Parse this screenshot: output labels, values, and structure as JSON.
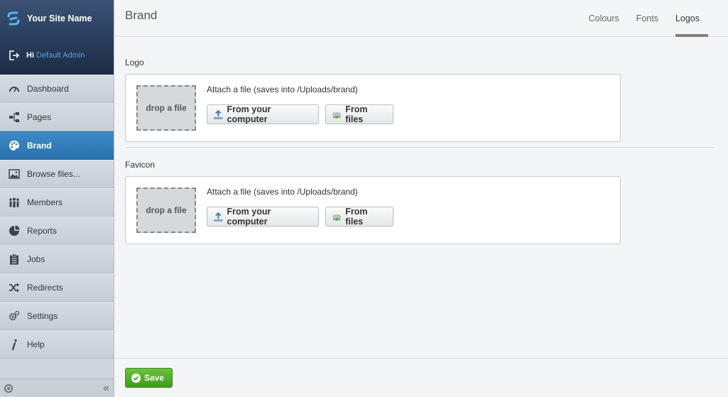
{
  "brand": {
    "site_name": "Your Site Name"
  },
  "user": {
    "greeting": "Hi",
    "name": "Default Admin"
  },
  "sidebar": {
    "items": [
      {
        "label": "Dashboard",
        "icon": "dashboard-gauge-icon"
      },
      {
        "label": "Pages",
        "icon": "sitemap-icon"
      },
      {
        "label": "Brand",
        "icon": "palette-icon",
        "active": true
      },
      {
        "label": "Browse files...",
        "icon": "image-icon"
      },
      {
        "label": "Members",
        "icon": "people-icon"
      },
      {
        "label": "Reports",
        "icon": "pie-chart-icon"
      },
      {
        "label": "Jobs",
        "icon": "clipboard-icon"
      },
      {
        "label": "Redirects",
        "icon": "shuffle-icon"
      },
      {
        "label": "Settings",
        "icon": "gears-icon"
      },
      {
        "label": "Help",
        "icon": "info-icon"
      }
    ],
    "footer": {
      "collapse_glyph": "«"
    }
  },
  "header": {
    "title": "Brand",
    "tabs": [
      {
        "label": "Colours"
      },
      {
        "label": "Fonts"
      },
      {
        "label": "Logos",
        "active": true
      }
    ]
  },
  "sections": [
    {
      "label": "Logo",
      "dropzone_text": "drop a file",
      "attach_text": "Attach a file (saves into /Uploads/brand)",
      "computer_button": "From your computer",
      "files_button": "From files"
    },
    {
      "label": "Favicon",
      "dropzone_text": "drop a file",
      "attach_text": "Attach a file (saves into /Uploads/brand)",
      "computer_button": "From your computer",
      "files_button": "From files"
    }
  ],
  "footer": {
    "save_label": "Save"
  },
  "colors": {
    "accent": "#2a71ac",
    "brand_bar": "#2a3f5e",
    "save_green": "#4caa28",
    "username_link": "#4fa3e8"
  }
}
